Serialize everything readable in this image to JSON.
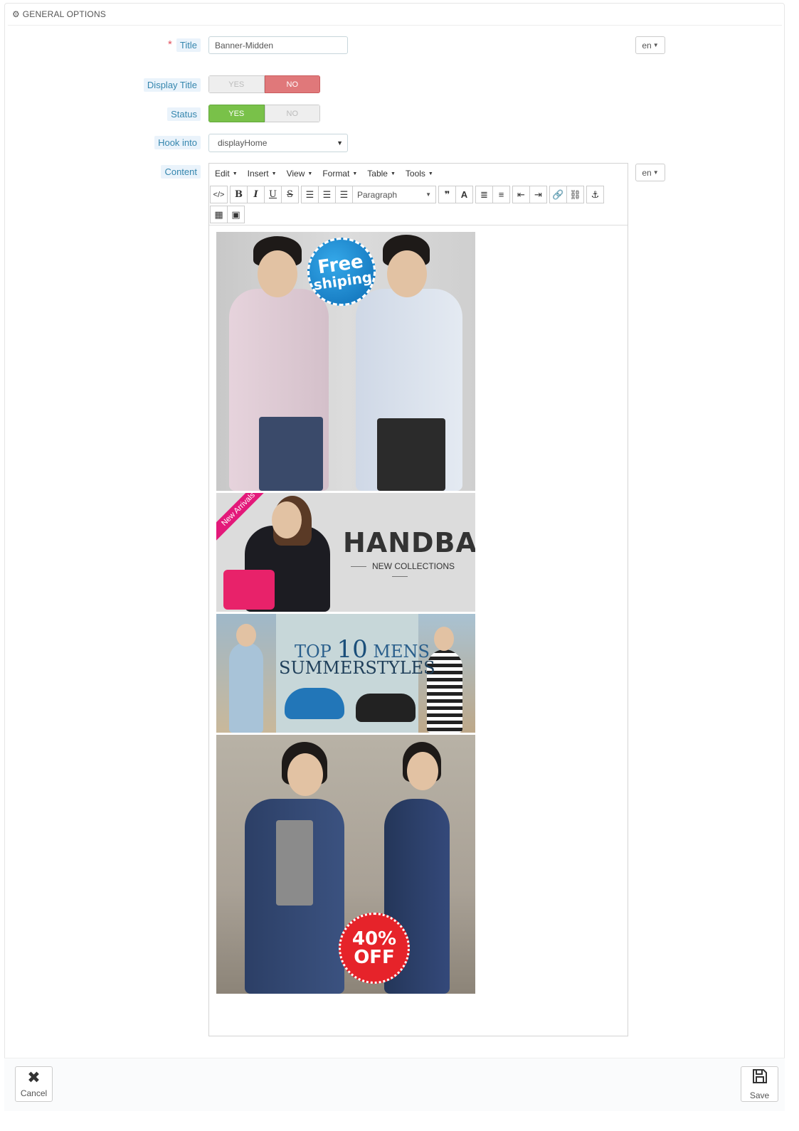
{
  "panel": {
    "heading": "GENERAL OPTIONS",
    "heading_icon": "gears-icon"
  },
  "form": {
    "title": {
      "label": "Title",
      "required_mark": "*",
      "value": "Banner-Midden",
      "lang": "en"
    },
    "display_title": {
      "label": "Display Title",
      "yes": "YES",
      "no": "NO",
      "selected": "NO"
    },
    "status": {
      "label": "Status",
      "yes": "YES",
      "no": "NO",
      "selected": "YES"
    },
    "hook_into": {
      "label": "Hook into",
      "value": "displayHome"
    },
    "content": {
      "label": "Content",
      "lang": "en"
    }
  },
  "editor": {
    "menu": [
      "Edit",
      "Insert",
      "View",
      "Format",
      "Table",
      "Tools"
    ],
    "format_select": "Paragraph",
    "toolbar_icons": [
      "source-code-icon",
      "bold-icon",
      "italic-icon",
      "underline-icon",
      "strikethrough-icon",
      "align-left-icon",
      "align-center-icon",
      "align-right-icon",
      "blockquote-icon",
      "text-color-icon",
      "bullet-list-icon",
      "numbered-list-icon",
      "outdent-icon",
      "indent-icon",
      "link-icon",
      "unlink-icon",
      "anchor-icon",
      "media-icon",
      "image-icon"
    ],
    "banners": {
      "free_shipping": {
        "line1": "Free",
        "line2": "shiping"
      },
      "handbag": {
        "ribbon": "New Arrivals",
        "title": "HANDBAG",
        "subtitle": "NEW COLLECTIONS"
      },
      "summer": {
        "top": "TOP",
        "ten": "10",
        "mens": "MENS",
        "line2": "SUMMERSTYLES"
      },
      "sale": {
        "line1": "40%",
        "line2": "OFF"
      }
    }
  },
  "footer": {
    "cancel": "Cancel",
    "save": "Save"
  },
  "colors": {
    "label_blue": "#3586ae",
    "switch_no": "#e0787a",
    "switch_yes": "#79c149",
    "required": "#e2515e"
  }
}
